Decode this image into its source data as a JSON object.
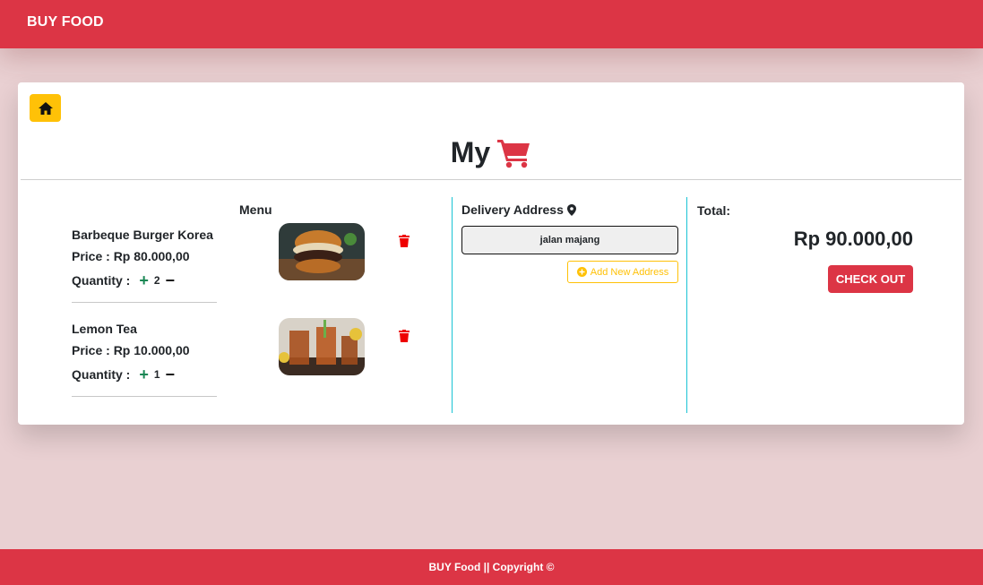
{
  "navbar": {
    "brand": "BUY FOOD"
  },
  "cart": {
    "title": "My",
    "menu_label": "Menu",
    "items": [
      {
        "name": "Barbeque Burger Korea",
        "price": "Price : Rp 80.000,00",
        "quantity_label": "Quantity :",
        "quantity": "2"
      },
      {
        "name": "Lemon Tea",
        "price": "Price : Rp 10.000,00",
        "quantity_label": "Quantity :",
        "quantity": "1"
      }
    ],
    "delivery": {
      "label": "Delivery Address",
      "address": "jalan majang",
      "add_button": "Add New Address"
    },
    "total": {
      "label": "Total:",
      "amount": "Rp 90.000,00",
      "checkout_button": "CHECK OUT"
    }
  },
  "footer": {
    "text": "BUY Food || Copyright ©"
  },
  "colors": {
    "primary": "#dc3545",
    "warning": "#ffc107",
    "success": "#198754",
    "info": "#19c3d4"
  },
  "icons": [
    "home-icon",
    "shopping-cart-icon",
    "plus-icon",
    "minus-icon",
    "trash-icon",
    "map-pin-icon",
    "plus-circle-icon"
  ]
}
